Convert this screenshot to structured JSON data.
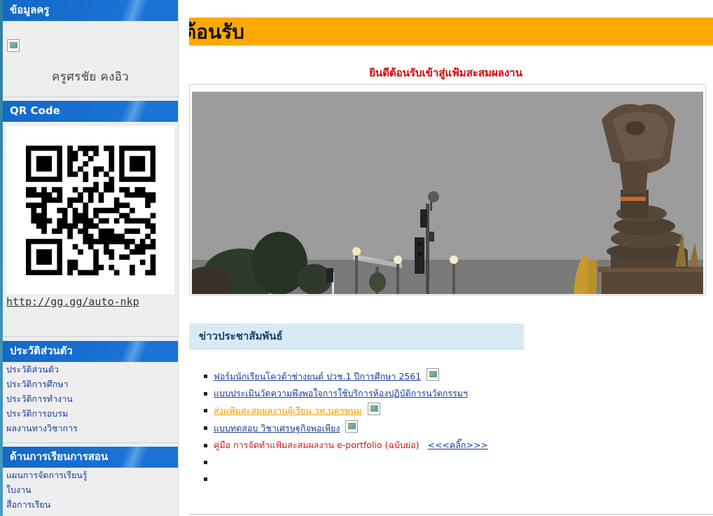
{
  "sidebar": {
    "teacher_box": {
      "title": "ข้อมูลครู",
      "name": "ครูศรชัย   คงอิว"
    },
    "qr_box": {
      "title": "QR Code",
      "link": "http://gg.gg/auto-nkp"
    },
    "profile_box": {
      "title": "ประวัติส่วนตัว",
      "items": [
        "ประวัติส่วนตัว",
        "ประวัติการศึกษา",
        "ประวัติการทำงาน",
        "ประวัติการอบรม",
        "ผลงานทางวิชาการ"
      ]
    },
    "teaching_box": {
      "title": "ด้านการเรียนการสอน",
      "items": [
        "แผนการจัดการเรียนรู้",
        "ใบงาน",
        "สื่อการเรียน"
      ]
    }
  },
  "main": {
    "banner_title": "ต้อนรับ",
    "welcome_message": "ยินดีต้อนรับเข้าสู่แฟ้มสะสมผลงาน",
    "news": {
      "title": "ข่าวประชาสัมพันธ์",
      "items": [
        {
          "text": "ฟอร์มนักเรียนโควต้าช่างยนต์ ปวช.1 ปีการศึกษา 2561",
          "suffix": ""
        },
        {
          "text": "แบบประเมินวัดความพึงพอใจการใช้บริการห้องปฏิบัติการนวัตกรรมฯ",
          "suffix": ""
        },
        {
          "text": "ส่งแฟ้มสะสมผลงานผู้เรียน วท.นครพนม",
          "suffix": ""
        },
        {
          "text": "แบบทดสอบ วิชาเศรษฐกิจพอเพียง",
          "suffix": ""
        },
        {
          "text": "คู่มือ การจัดทำแฟ้มสะสมผลงาน e-portfolio (ฉบับย่อ)",
          "suffix": "<<<คลิ๊ก>>>"
        }
      ]
    }
  }
}
